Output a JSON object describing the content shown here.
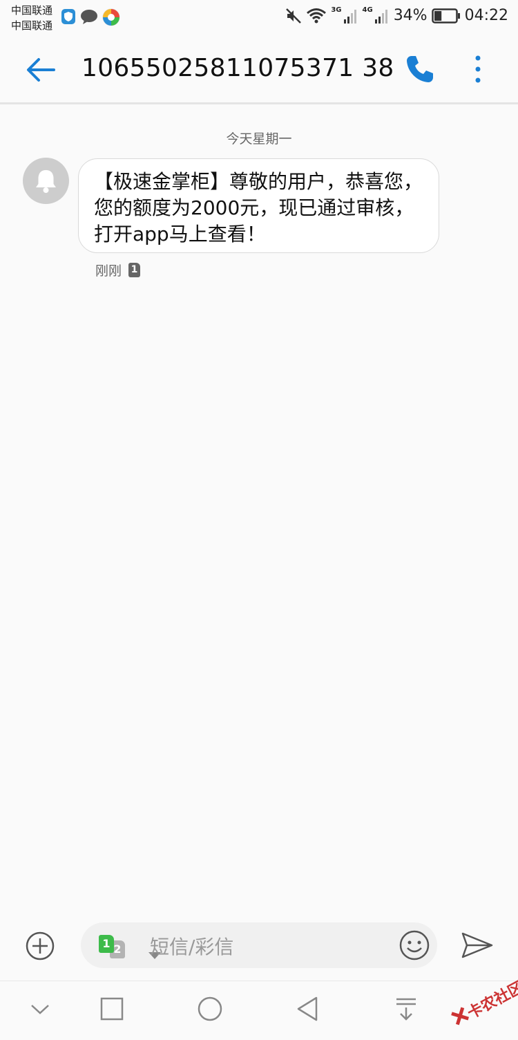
{
  "status_bar": {
    "carrier_line1": "中国联通",
    "carrier_line2": "中国联通",
    "notification_icons": [
      "shield-icon",
      "chat-bubble-icon",
      "ball-app-icon"
    ],
    "network_1": "3G",
    "network_2": "4G",
    "battery_percent": "34%",
    "battery_level": 0.34,
    "time": "04:22"
  },
  "header": {
    "contact_number": "10655025811075371 38",
    "icons": {
      "back": "back-arrow-icon",
      "call": "phone-icon",
      "more": "more-vertical-icon"
    },
    "accent_color": "#1a7fd4"
  },
  "thread": {
    "date_divider": "今天星期一",
    "messages": [
      {
        "text": "【极速金掌柜】尊敬的用户，恭喜您，您的额度为2000元，现已通过审核，打开app马上查看！",
        "timestamp": "刚刚",
        "sim": "1",
        "avatar_icon": "bell-icon"
      }
    ]
  },
  "composer": {
    "placeholder": "短信/彩信",
    "sim_primary": "1",
    "sim_secondary": "2",
    "sim_primary_color": "#3dbb4a",
    "icons": {
      "add": "add-circle-icon",
      "emoji": "emoji-icon",
      "send": "send-icon"
    }
  },
  "navigation_bar": {
    "icons": [
      "collapse-down-icon",
      "recents-square-icon",
      "home-circle-icon",
      "back-triangle-icon",
      "notification-pulldown-icon"
    ]
  },
  "watermark": {
    "text": "卡农社区"
  }
}
